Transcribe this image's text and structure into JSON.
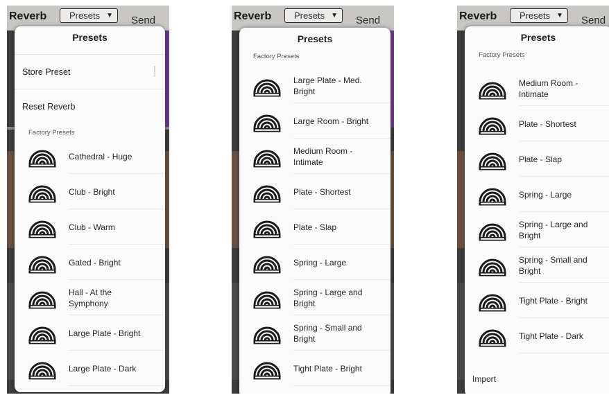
{
  "app": {
    "title": "Reverb",
    "presets_button": "Presets",
    "send_label": "Send",
    "presets_caret": "▼"
  },
  "popover": {
    "title": "Presets"
  },
  "actions": {
    "store": "Store Preset",
    "reset": "Reset Reverb",
    "import": "Import"
  },
  "section": {
    "factory": "Factory Presets"
  },
  "icon": "reverb-arch-icon",
  "panel1": {
    "items": [
      {
        "label": "Cathedral - Huge"
      },
      {
        "label": "Club - Bright"
      },
      {
        "label": "Club - Warm"
      },
      {
        "label": "Gated - Bright"
      },
      {
        "label": "Hall - At the Symphony"
      },
      {
        "label": "Large Plate - Bright"
      },
      {
        "label": "Large Plate - Dark"
      }
    ]
  },
  "panel2": {
    "items": [
      {
        "label": "Large Plate - Med. Bright"
      },
      {
        "label": "Large Room - Bright"
      },
      {
        "label": "Medium Room - Intimate"
      },
      {
        "label": "Plate - Shortest"
      },
      {
        "label": "Plate - Slap"
      },
      {
        "label": "Spring - Large"
      },
      {
        "label": "Spring - Large and Bright"
      },
      {
        "label": "Spring - Small and Bright"
      },
      {
        "label": "Tight Plate - Bright"
      }
    ]
  },
  "panel3": {
    "items": [
      {
        "label": "Medium Room - Intimate"
      },
      {
        "label": "Plate - Shortest"
      },
      {
        "label": "Plate - Slap"
      },
      {
        "label": "Spring - Large"
      },
      {
        "label": "Spring - Large and Bright"
      },
      {
        "label": "Spring - Small and Bright"
      },
      {
        "label": "Tight Plate - Bright"
      },
      {
        "label": "Tight Plate - Dark"
      }
    ]
  }
}
